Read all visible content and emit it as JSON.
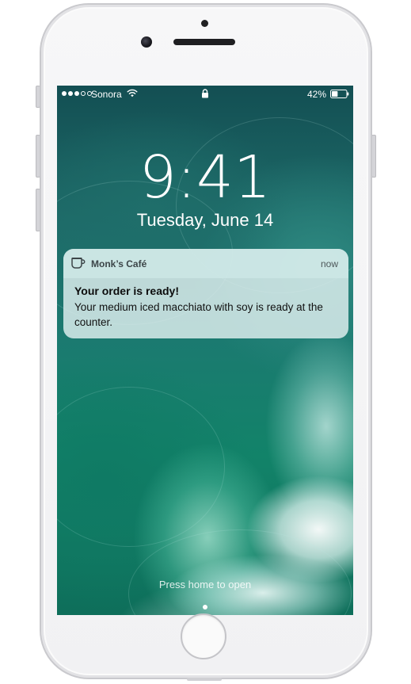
{
  "status_bar": {
    "signal_bars_filled": 3,
    "signal_bars_total": 5,
    "carrier": "Sonora",
    "wifi_icon": "wifi-icon",
    "lock_icon": "lock-icon",
    "battery_percent": "42%",
    "battery_level": 0.42
  },
  "lock_screen": {
    "time": "9:41",
    "date": "Tuesday, June 14",
    "unlock_hint": "Press home to open"
  },
  "notification": {
    "app_icon": "coffee-cup-icon",
    "app_name": "Monk’s Café",
    "time": "now",
    "title": "Your order is ready!",
    "body": "Your medium iced macchiato with soy is ready at the counter."
  },
  "colors": {
    "screen_base": "#1b7a70",
    "text_primary": "#ffffff",
    "notification_bg": "#e2f0f0"
  }
}
